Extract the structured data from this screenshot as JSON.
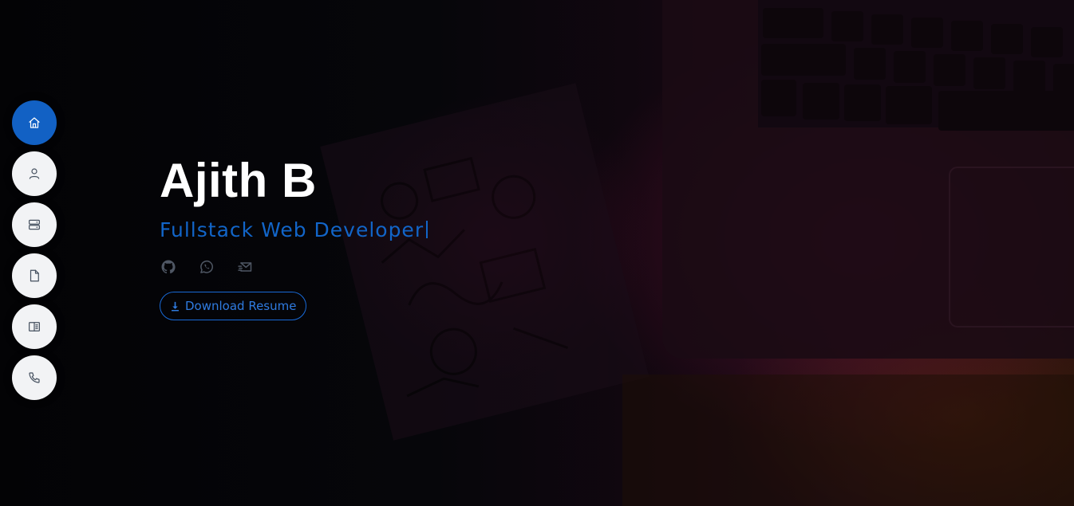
{
  "hero": {
    "name": "Ajith B",
    "role": "Fullstack Web Developer"
  },
  "nav": {
    "items": [
      {
        "name": "home",
        "icon": "home-icon",
        "active": true
      },
      {
        "name": "about",
        "icon": "user-icon",
        "active": false
      },
      {
        "name": "services",
        "icon": "server-icon",
        "active": false
      },
      {
        "name": "resume",
        "icon": "file-icon",
        "active": false
      },
      {
        "name": "portfolio",
        "icon": "book-icon",
        "active": false
      },
      {
        "name": "contact",
        "icon": "phone-icon",
        "active": false
      }
    ]
  },
  "socials": [
    {
      "name": "github",
      "icon": "github-icon"
    },
    {
      "name": "whatsapp",
      "icon": "whatsapp-icon"
    },
    {
      "name": "email",
      "icon": "mail-icon"
    }
  ],
  "resume_button": {
    "label": "Download Resume",
    "icon": "download-icon"
  },
  "colors": {
    "accent": "#1261c4",
    "nav_bg": "#f2f3f5",
    "name_text": "#ffffff",
    "role_text": "#1265c8"
  }
}
